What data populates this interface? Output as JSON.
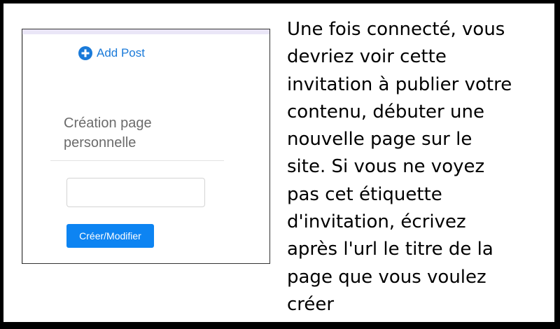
{
  "screenshot": {
    "add_post_label": "Add Post",
    "add_post_icon": "plus-circle-icon",
    "section_title": "Création page personnelle",
    "input_value": "",
    "button_label": "Créer/Modifier",
    "accent_color": "#0d84f2"
  },
  "instructions": {
    "text": "Une fois connecté, vous\ndevriez voir cette\ninvitation à publier votre\ncontenu, débuter une\nnouvelle page sur le\nsite.  Si vous ne voyez\npas cet étiquette\nd'invitation, écrivez\naprès l'url le titre de la\npage que vous voulez\ncréer"
  }
}
